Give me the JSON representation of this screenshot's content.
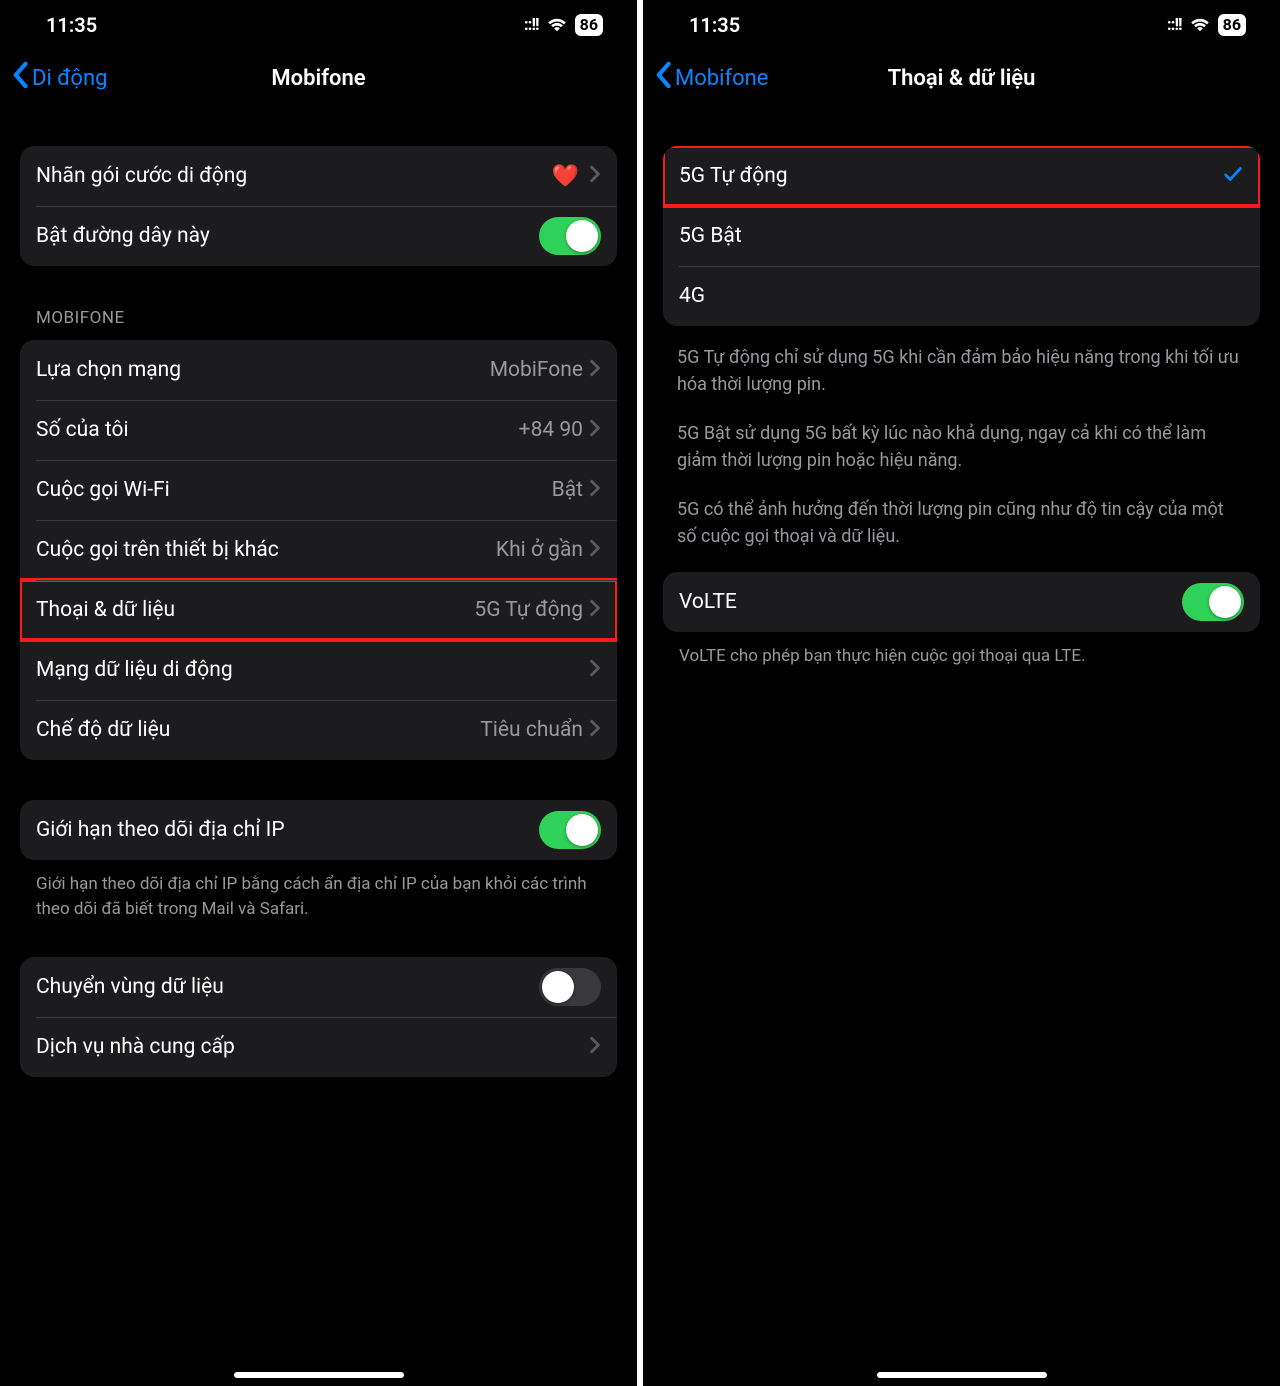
{
  "status": {
    "time": "11:35",
    "signal": "::!!",
    "battery": "86"
  },
  "left": {
    "back": "Di động",
    "title": "Mobifone",
    "group1": {
      "plan_label": "Nhãn gói cước di động",
      "heart": "❤️",
      "line_toggle_label": "Bật đường dây này"
    },
    "section_header": "MOBIFONE",
    "rows": {
      "network_sel": {
        "label": "Lựa chọn mạng",
        "value": "MobiFone"
      },
      "my_number": {
        "label": "Số của tôi",
        "value": "+84 90"
      },
      "wifi_call": {
        "label": "Cuộc gọi Wi-Fi",
        "value": "Bật"
      },
      "other_dev": {
        "label": "Cuộc gọi trên thiết bị khác",
        "value": "Khi ở gần"
      },
      "voice_data": {
        "label": "Thoại & dữ liệu",
        "value": "5G Tự động"
      },
      "data_net": {
        "label": "Mạng dữ liệu di động",
        "value": ""
      },
      "data_mode": {
        "label": "Chế độ dữ liệu",
        "value": "Tiêu chuẩn"
      }
    },
    "ip_limit": {
      "label": "Giới hạn theo dõi địa chỉ IP",
      "note": "Giới hạn theo dõi địa chỉ IP bằng cách ẩn địa chỉ IP của bạn khỏi các trình theo dõi đã biết trong Mail và Safari."
    },
    "roaming": {
      "label": "Chuyển vùng dữ liệu"
    },
    "carrier_services": {
      "label": "Dịch vụ nhà cung cấp"
    }
  },
  "right": {
    "back": "Mobifone",
    "title": "Thoại & dữ liệu",
    "options": {
      "auto": "5G Tự động",
      "on": "5G Bật",
      "fourg": "4G"
    },
    "desc1": "5G Tự động chỉ sử dụng 5G khi cần đảm bảo hiệu năng trong khi tối ưu hóa thời lượng pin.",
    "desc2": "5G Bật sử dụng 5G bất kỳ lúc nào khả dụng, ngay cả khi có thể làm giảm thời lượng pin hoặc hiệu năng.",
    "desc3": "5G có thể ảnh hưởng đến thời lượng pin cũng như độ tin cậy của một số cuộc gọi thoại và dữ liệu.",
    "volte": {
      "label": "VoLTE",
      "note": "VoLTE cho phép bạn thực hiện cuộc gọi thoại qua LTE."
    }
  }
}
